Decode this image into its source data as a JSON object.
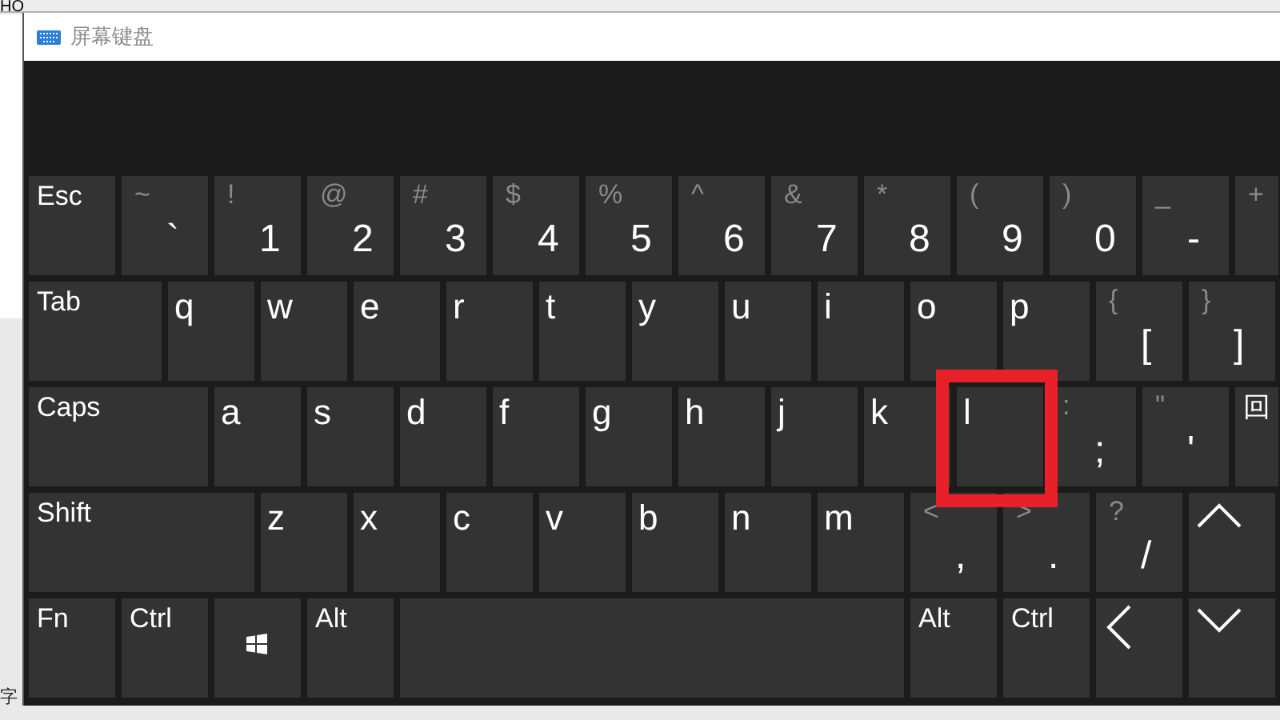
{
  "background": {
    "top_text": "HO",
    "bottom_text": "字"
  },
  "window": {
    "title": "屏幕键盘"
  },
  "rows": [
    {
      "keys": [
        {
          "kind": "function",
          "label": "Esc",
          "highlighted": false
        },
        {
          "kind": "symbol",
          "shift": "~",
          "label": "`",
          "highlighted": false
        },
        {
          "kind": "symbol",
          "shift": "!",
          "label": "1",
          "highlighted": false
        },
        {
          "kind": "symbol",
          "shift": "@",
          "label": "2",
          "highlighted": false
        },
        {
          "kind": "symbol",
          "shift": "#",
          "label": "3",
          "highlighted": false
        },
        {
          "kind": "symbol",
          "shift": "$",
          "label": "4",
          "highlighted": false
        },
        {
          "kind": "symbol",
          "shift": "%",
          "label": "5",
          "highlighted": false
        },
        {
          "kind": "symbol",
          "shift": "^",
          "label": "6",
          "highlighted": false
        },
        {
          "kind": "symbol",
          "shift": "&",
          "label": "7",
          "highlighted": false
        },
        {
          "kind": "symbol",
          "shift": "*",
          "label": "8",
          "highlighted": false
        },
        {
          "kind": "symbol",
          "shift": "(",
          "label": "9",
          "highlighted": false
        },
        {
          "kind": "symbol",
          "shift": ")",
          "label": "0",
          "highlighted": false
        },
        {
          "kind": "symbol",
          "shift": "_",
          "label": "-",
          "highlighted": false
        },
        {
          "kind": "symbol",
          "shift": "+",
          "highlighted": false
        }
      ]
    },
    {
      "keys": [
        {
          "kind": "function",
          "label": "Tab",
          "highlighted": false
        },
        {
          "kind": "letter",
          "label": "q",
          "highlighted": false
        },
        {
          "kind": "letter",
          "label": "w",
          "highlighted": false
        },
        {
          "kind": "letter",
          "label": "e",
          "highlighted": false
        },
        {
          "kind": "letter",
          "label": "r",
          "highlighted": false
        },
        {
          "kind": "letter",
          "label": "t",
          "highlighted": false
        },
        {
          "kind": "letter",
          "label": "y",
          "highlighted": false
        },
        {
          "kind": "letter",
          "label": "u",
          "highlighted": false
        },
        {
          "kind": "letter",
          "label": "i",
          "highlighted": false
        },
        {
          "kind": "letter",
          "label": "o",
          "highlighted": false
        },
        {
          "kind": "letter",
          "label": "p",
          "highlighted": false
        },
        {
          "kind": "symbol",
          "shift": "{",
          "label": "[",
          "highlighted": false
        },
        {
          "kind": "symbol",
          "shift": "}",
          "label": "]",
          "highlighted": false
        }
      ]
    },
    {
      "keys": [
        {
          "kind": "function",
          "label": "Caps",
          "highlighted": false
        },
        {
          "kind": "letter",
          "label": "a",
          "highlighted": false
        },
        {
          "kind": "letter",
          "label": "s",
          "highlighted": false
        },
        {
          "kind": "letter",
          "label": "d",
          "highlighted": false
        },
        {
          "kind": "letter",
          "label": "f",
          "highlighted": false
        },
        {
          "kind": "letter",
          "label": "g",
          "highlighted": false
        },
        {
          "kind": "letter",
          "label": "h",
          "highlighted": false
        },
        {
          "kind": "letter",
          "label": "j",
          "highlighted": false
        },
        {
          "kind": "letter",
          "label": "k",
          "highlighted": false
        },
        {
          "kind": "letter",
          "label": "l",
          "highlighted": true
        },
        {
          "kind": "symbol",
          "shift": ":",
          "label": ";",
          "highlighted": false
        },
        {
          "kind": "symbol",
          "shift": "\"",
          "label": "'",
          "highlighted": false
        },
        {
          "kind": "function",
          "label": "回",
          "highlighted": false
        }
      ]
    },
    {
      "keys": [
        {
          "kind": "function",
          "label": "Shift",
          "highlighted": false
        },
        {
          "kind": "letter",
          "label": "z",
          "highlighted": false
        },
        {
          "kind": "letter",
          "label": "x",
          "highlighted": false
        },
        {
          "kind": "letter",
          "label": "c",
          "highlighted": false
        },
        {
          "kind": "letter",
          "label": "v",
          "highlighted": false
        },
        {
          "kind": "letter",
          "label": "b",
          "highlighted": false
        },
        {
          "kind": "letter",
          "label": "n",
          "highlighted": false
        },
        {
          "kind": "letter",
          "label": "m",
          "highlighted": false
        },
        {
          "kind": "symbol",
          "shift": "<",
          "label": ",",
          "highlighted": false
        },
        {
          "kind": "symbol",
          "shift": ">",
          "label": ".",
          "highlighted": false
        },
        {
          "kind": "symbol",
          "shift": "?",
          "label": "/",
          "highlighted": false
        },
        {
          "kind": "arrow-up",
          "highlighted": false
        }
      ]
    },
    {
      "keys": [
        {
          "kind": "function",
          "label": "Fn",
          "highlighted": false
        },
        {
          "kind": "function",
          "label": "Ctrl",
          "highlighted": false
        },
        {
          "kind": "windows",
          "highlighted": false
        },
        {
          "kind": "function",
          "label": "Alt",
          "highlighted": false
        },
        {
          "kind": "space",
          "highlighted": false
        },
        {
          "kind": "function",
          "label": "Alt",
          "highlighted": false
        },
        {
          "kind": "function",
          "label": "Ctrl",
          "highlighted": false
        },
        {
          "kind": "arrow-left",
          "highlighted": false
        },
        {
          "kind": "arrow-down",
          "highlighted": false
        }
      ]
    }
  ]
}
